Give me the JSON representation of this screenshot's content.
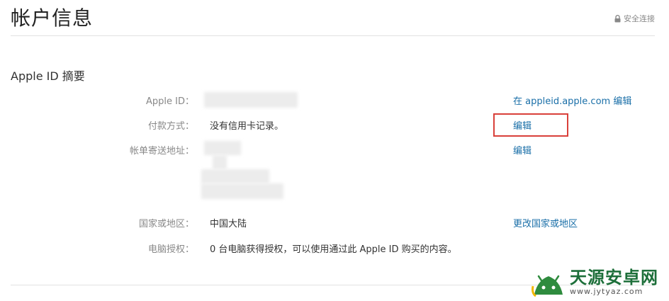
{
  "header": {
    "title": "帐户信息",
    "secure_label": "安全连接"
  },
  "section": {
    "title": "Apple ID 摘要"
  },
  "rows": {
    "apple_id": {
      "label": "Apple ID：",
      "value": "",
      "action": "在 appleid.apple.com 编辑"
    },
    "payment": {
      "label": "付款方式：",
      "value": "没有信用卡记录。",
      "action": "编辑"
    },
    "billing": {
      "label": "帐单寄送地址：",
      "value": "",
      "action": "编辑"
    },
    "country": {
      "label": "国家或地区：",
      "value": "中国大陆",
      "action": "更改国家或地区"
    },
    "authorization": {
      "label": "电脑授权：",
      "value": "0 台电脑获得授权，可以使用通过此 Apple ID 购买的内容。"
    }
  },
  "watermark": {
    "name": "天源安卓网",
    "url": "www.jytyaz.com"
  },
  "colors": {
    "link": "#1a6fa8",
    "highlight": "#d9403a",
    "watermark_green": "#1d6f3a"
  }
}
